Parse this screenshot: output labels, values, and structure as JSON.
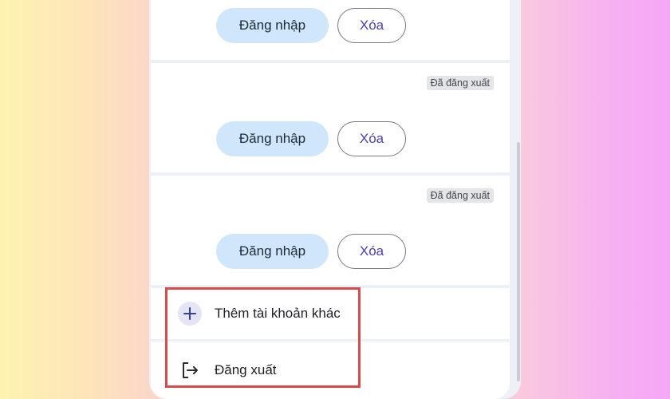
{
  "accounts": [
    {
      "status": "",
      "login_label": "Đăng nhập",
      "delete_label": "Xóa"
    },
    {
      "status": "Đã đăng xuất",
      "login_label": "Đăng nhập",
      "delete_label": "Xóa"
    },
    {
      "status": "Đã đăng xuất",
      "login_label": "Đăng nhập",
      "delete_label": "Xóa"
    }
  ],
  "menu": {
    "add_account_label": "Thêm tài khoản khác",
    "add_account_icon": "plus-icon",
    "logout_label": "Đăng xuất",
    "logout_icon": "logout-arrow-icon"
  },
  "colors": {
    "login_button_bg": "#cfe6fb",
    "delete_button_text": "#4a3fb5",
    "highlight_border": "#d94a4a"
  }
}
